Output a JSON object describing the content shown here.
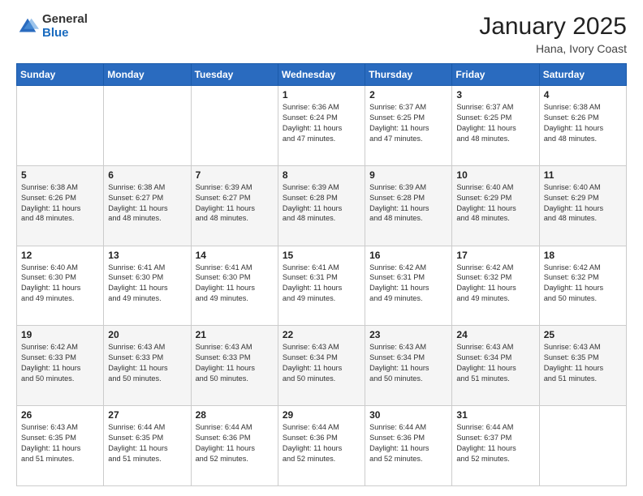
{
  "logo": {
    "general": "General",
    "blue": "Blue"
  },
  "header": {
    "title": "January 2025",
    "location": "Hana, Ivory Coast"
  },
  "weekdays": [
    "Sunday",
    "Monday",
    "Tuesday",
    "Wednesday",
    "Thursday",
    "Friday",
    "Saturday"
  ],
  "weeks": [
    [
      {
        "day": "",
        "info": ""
      },
      {
        "day": "",
        "info": ""
      },
      {
        "day": "",
        "info": ""
      },
      {
        "day": "1",
        "info": "Sunrise: 6:36 AM\nSunset: 6:24 PM\nDaylight: 11 hours\nand 47 minutes."
      },
      {
        "day": "2",
        "info": "Sunrise: 6:37 AM\nSunset: 6:25 PM\nDaylight: 11 hours\nand 47 minutes."
      },
      {
        "day": "3",
        "info": "Sunrise: 6:37 AM\nSunset: 6:25 PM\nDaylight: 11 hours\nand 48 minutes."
      },
      {
        "day": "4",
        "info": "Sunrise: 6:38 AM\nSunset: 6:26 PM\nDaylight: 11 hours\nand 48 minutes."
      }
    ],
    [
      {
        "day": "5",
        "info": "Sunrise: 6:38 AM\nSunset: 6:26 PM\nDaylight: 11 hours\nand 48 minutes."
      },
      {
        "day": "6",
        "info": "Sunrise: 6:38 AM\nSunset: 6:27 PM\nDaylight: 11 hours\nand 48 minutes."
      },
      {
        "day": "7",
        "info": "Sunrise: 6:39 AM\nSunset: 6:27 PM\nDaylight: 11 hours\nand 48 minutes."
      },
      {
        "day": "8",
        "info": "Sunrise: 6:39 AM\nSunset: 6:28 PM\nDaylight: 11 hours\nand 48 minutes."
      },
      {
        "day": "9",
        "info": "Sunrise: 6:39 AM\nSunset: 6:28 PM\nDaylight: 11 hours\nand 48 minutes."
      },
      {
        "day": "10",
        "info": "Sunrise: 6:40 AM\nSunset: 6:29 PM\nDaylight: 11 hours\nand 48 minutes."
      },
      {
        "day": "11",
        "info": "Sunrise: 6:40 AM\nSunset: 6:29 PM\nDaylight: 11 hours\nand 48 minutes."
      }
    ],
    [
      {
        "day": "12",
        "info": "Sunrise: 6:40 AM\nSunset: 6:30 PM\nDaylight: 11 hours\nand 49 minutes."
      },
      {
        "day": "13",
        "info": "Sunrise: 6:41 AM\nSunset: 6:30 PM\nDaylight: 11 hours\nand 49 minutes."
      },
      {
        "day": "14",
        "info": "Sunrise: 6:41 AM\nSunset: 6:30 PM\nDaylight: 11 hours\nand 49 minutes."
      },
      {
        "day": "15",
        "info": "Sunrise: 6:41 AM\nSunset: 6:31 PM\nDaylight: 11 hours\nand 49 minutes."
      },
      {
        "day": "16",
        "info": "Sunrise: 6:42 AM\nSunset: 6:31 PM\nDaylight: 11 hours\nand 49 minutes."
      },
      {
        "day": "17",
        "info": "Sunrise: 6:42 AM\nSunset: 6:32 PM\nDaylight: 11 hours\nand 49 minutes."
      },
      {
        "day": "18",
        "info": "Sunrise: 6:42 AM\nSunset: 6:32 PM\nDaylight: 11 hours\nand 50 minutes."
      }
    ],
    [
      {
        "day": "19",
        "info": "Sunrise: 6:42 AM\nSunset: 6:33 PM\nDaylight: 11 hours\nand 50 minutes."
      },
      {
        "day": "20",
        "info": "Sunrise: 6:43 AM\nSunset: 6:33 PM\nDaylight: 11 hours\nand 50 minutes."
      },
      {
        "day": "21",
        "info": "Sunrise: 6:43 AM\nSunset: 6:33 PM\nDaylight: 11 hours\nand 50 minutes."
      },
      {
        "day": "22",
        "info": "Sunrise: 6:43 AM\nSunset: 6:34 PM\nDaylight: 11 hours\nand 50 minutes."
      },
      {
        "day": "23",
        "info": "Sunrise: 6:43 AM\nSunset: 6:34 PM\nDaylight: 11 hours\nand 50 minutes."
      },
      {
        "day": "24",
        "info": "Sunrise: 6:43 AM\nSunset: 6:34 PM\nDaylight: 11 hours\nand 51 minutes."
      },
      {
        "day": "25",
        "info": "Sunrise: 6:43 AM\nSunset: 6:35 PM\nDaylight: 11 hours\nand 51 minutes."
      }
    ],
    [
      {
        "day": "26",
        "info": "Sunrise: 6:43 AM\nSunset: 6:35 PM\nDaylight: 11 hours\nand 51 minutes."
      },
      {
        "day": "27",
        "info": "Sunrise: 6:44 AM\nSunset: 6:35 PM\nDaylight: 11 hours\nand 51 minutes."
      },
      {
        "day": "28",
        "info": "Sunrise: 6:44 AM\nSunset: 6:36 PM\nDaylight: 11 hours\nand 52 minutes."
      },
      {
        "day": "29",
        "info": "Sunrise: 6:44 AM\nSunset: 6:36 PM\nDaylight: 11 hours\nand 52 minutes."
      },
      {
        "day": "30",
        "info": "Sunrise: 6:44 AM\nSunset: 6:36 PM\nDaylight: 11 hours\nand 52 minutes."
      },
      {
        "day": "31",
        "info": "Sunrise: 6:44 AM\nSunset: 6:37 PM\nDaylight: 11 hours\nand 52 minutes."
      },
      {
        "day": "",
        "info": ""
      }
    ]
  ]
}
